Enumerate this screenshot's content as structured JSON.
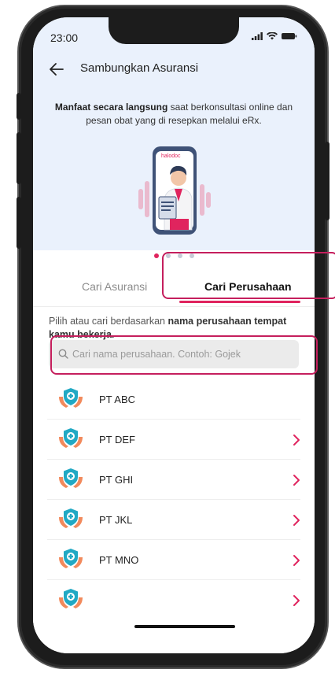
{
  "status": {
    "time": "23:00"
  },
  "appbar": {
    "title": "Sambungkan Asuransi"
  },
  "hero": {
    "bold": "Manfaat secara langsung",
    "rest": " saat berkonsultasi online dan pesan obat yang di resepkan melalui eRx.",
    "brand": "halodoc",
    "carousel_index": 1,
    "carousel_count": 4
  },
  "tabs": [
    {
      "label": "Cari Asuransi",
      "active": false
    },
    {
      "label": "Cari Perusahaan",
      "active": true
    }
  ],
  "instruction": {
    "plain": "Pilih atau cari berdasarkan ",
    "bold": "nama perusahaan tempat kamu bekerja."
  },
  "search": {
    "placeholder": "Cari nama perusahaan. Contoh: Gojek",
    "value": ""
  },
  "companies": [
    {
      "name": "PT ABC",
      "chevron": false
    },
    {
      "name": "PT DEF",
      "chevron": true
    },
    {
      "name": "PT GHI",
      "chevron": true
    },
    {
      "name": "PT JKL",
      "chevron": true
    },
    {
      "name": "PT MNO",
      "chevron": true
    },
    {
      "name": "",
      "chevron": true
    }
  ],
  "colors": {
    "accent": "#e0245e",
    "hero_bg": "#eaf1fc",
    "highlight": "#c51f5d"
  }
}
